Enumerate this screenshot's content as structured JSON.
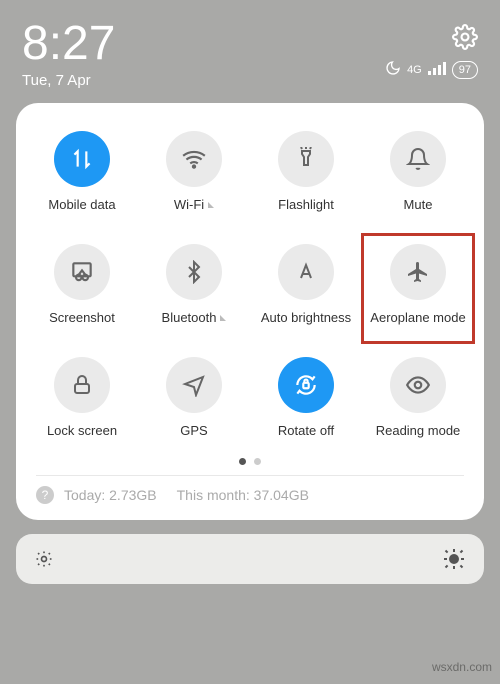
{
  "status": {
    "time": "8:27",
    "date": "Tue, 7 Apr",
    "network_label": "4G",
    "battery": "97"
  },
  "tiles": [
    {
      "key": "mobile-data",
      "label": "Mobile data",
      "active": true,
      "expandable": false
    },
    {
      "key": "wifi",
      "label": "Wi-Fi",
      "active": false,
      "expandable": true
    },
    {
      "key": "flashlight",
      "label": "Flashlight",
      "active": false,
      "expandable": false
    },
    {
      "key": "mute",
      "label": "Mute",
      "active": false,
      "expandable": false
    },
    {
      "key": "screenshot",
      "label": "Screenshot",
      "active": false,
      "expandable": false
    },
    {
      "key": "bluetooth",
      "label": "Bluetooth",
      "active": false,
      "expandable": true
    },
    {
      "key": "auto-brightness",
      "label": "Auto brightness",
      "active": false,
      "expandable": false
    },
    {
      "key": "aeroplane-mode",
      "label": "Aeroplane mode",
      "active": false,
      "expandable": false
    },
    {
      "key": "lock-screen",
      "label": "Lock screen",
      "active": false,
      "expandable": false
    },
    {
      "key": "gps",
      "label": "GPS",
      "active": false,
      "expandable": false
    },
    {
      "key": "rotate-off",
      "label": "Rotate off",
      "active": true,
      "expandable": false
    },
    {
      "key": "reading-mode",
      "label": "Reading mode",
      "active": false,
      "expandable": false
    }
  ],
  "pager": {
    "total": 2,
    "current": 0
  },
  "usage": {
    "today_label": "Today:",
    "today_value": "2.73GB",
    "month_label": "This month:",
    "month_value": "37.04GB"
  },
  "highlight_tile": "aeroplane-mode",
  "watermark": "wsxdn.com"
}
